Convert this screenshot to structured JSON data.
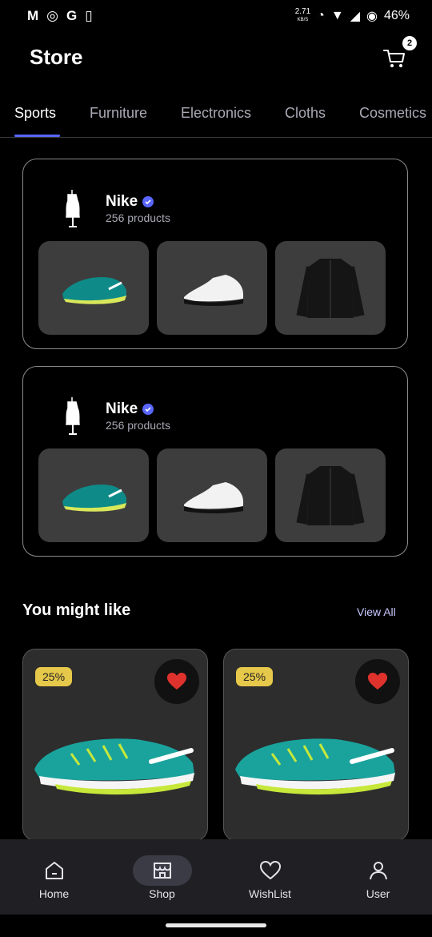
{
  "status_bar": {
    "left_icons": [
      "gmail-icon",
      "shield-app-icon",
      "google-icon",
      "battery-saver-icon"
    ],
    "net_speed_value": "2.71",
    "net_speed_unit": "KB/S",
    "battery": "46%"
  },
  "header": {
    "title": "Store",
    "cart_count": "2"
  },
  "tabs": [
    {
      "label": "Sports"
    },
    {
      "label": "Furniture"
    },
    {
      "label": "Electronics"
    },
    {
      "label": "Cloths"
    },
    {
      "label": "Cosmetics"
    }
  ],
  "brands": [
    {
      "name": "Nike",
      "count": "256 products",
      "thumbs": [
        "running-shoe",
        "sneaker",
        "jacket"
      ]
    },
    {
      "name": "Nike",
      "count": "256 products",
      "thumbs": [
        "running-shoe",
        "sneaker",
        "jacket"
      ]
    }
  ],
  "section": {
    "title": "You might like",
    "view_all": "View All"
  },
  "products": [
    {
      "discount": "25%"
    },
    {
      "discount": "25%"
    }
  ],
  "bottom_nav": [
    {
      "label": "Home",
      "icon": "home-icon"
    },
    {
      "label": "Shop",
      "icon": "shop-icon"
    },
    {
      "label": "WishList",
      "icon": "heart-icon"
    },
    {
      "label": "User",
      "icon": "user-icon"
    }
  ],
  "colors": {
    "accent": "#5966ff",
    "discount": "#e6c84a",
    "heart": "#e0322d"
  }
}
